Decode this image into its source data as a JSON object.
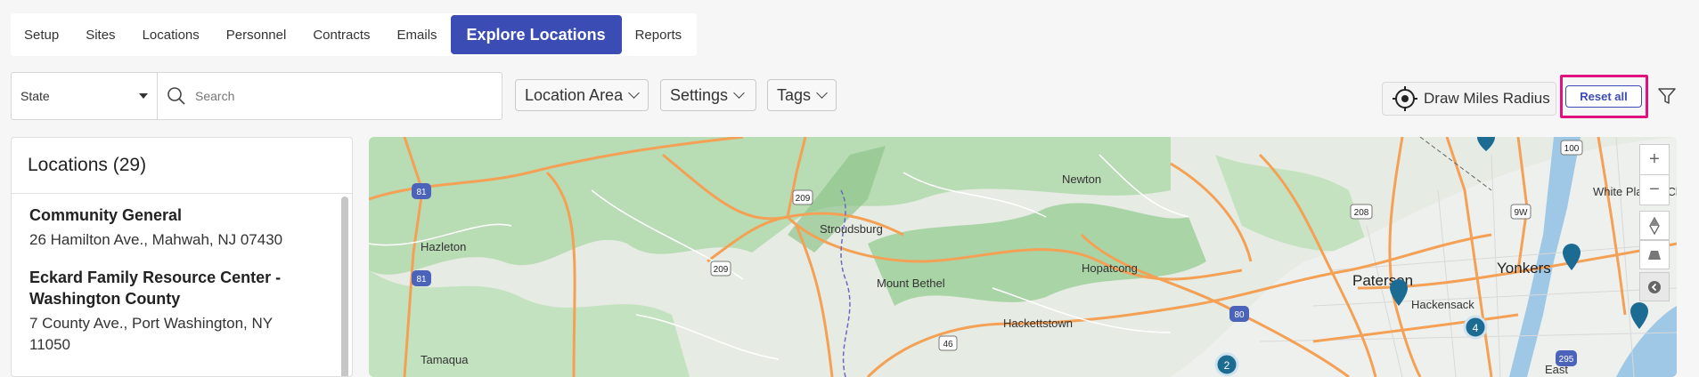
{
  "nav": {
    "tabs": [
      {
        "label": "Setup"
      },
      {
        "label": "Sites"
      },
      {
        "label": "Locations"
      },
      {
        "label": "Personnel"
      },
      {
        "label": "Contracts"
      },
      {
        "label": "Emails"
      },
      {
        "label": "Explore Locations"
      },
      {
        "label": "Reports"
      }
    ],
    "active": "Explore Locations"
  },
  "filters": {
    "state_value": "State",
    "search_placeholder": "Search",
    "location_area": "Location Area",
    "settings": "Settings",
    "tags": "Tags",
    "draw_radius": "Draw Miles Radius",
    "reset_all": "Reset all"
  },
  "locations": {
    "title": "Locations (29)",
    "items": [
      {
        "name": "Community General",
        "address": "26 Hamilton Ave., Mahwah, NJ 07430"
      },
      {
        "name": "Eckard Family Resource Center - Washington County",
        "address": "7 County Ave., Port Washington, NY 11050"
      }
    ]
  },
  "map": {
    "places": [
      "Hazleton",
      "Stroudsburg",
      "Newton",
      "Hopatcong",
      "Mount Bethel",
      "Hackettstown",
      "Tamaqua",
      "Paterson",
      "Hackensack",
      "Yonkers",
      "White Plains",
      "Port Ch",
      "East"
    ],
    "route_shields": [
      "81",
      "209",
      "209",
      "81",
      "46",
      "80",
      "208",
      "9W",
      "100",
      "295"
    ],
    "clusters": [
      {
        "count": "4"
      },
      {
        "count": "2"
      }
    ],
    "zoom_in": "+",
    "zoom_out": "−",
    "accent": "#3b4db4",
    "highlight": "#e0127d",
    "marker_color": "#1c6b93"
  }
}
